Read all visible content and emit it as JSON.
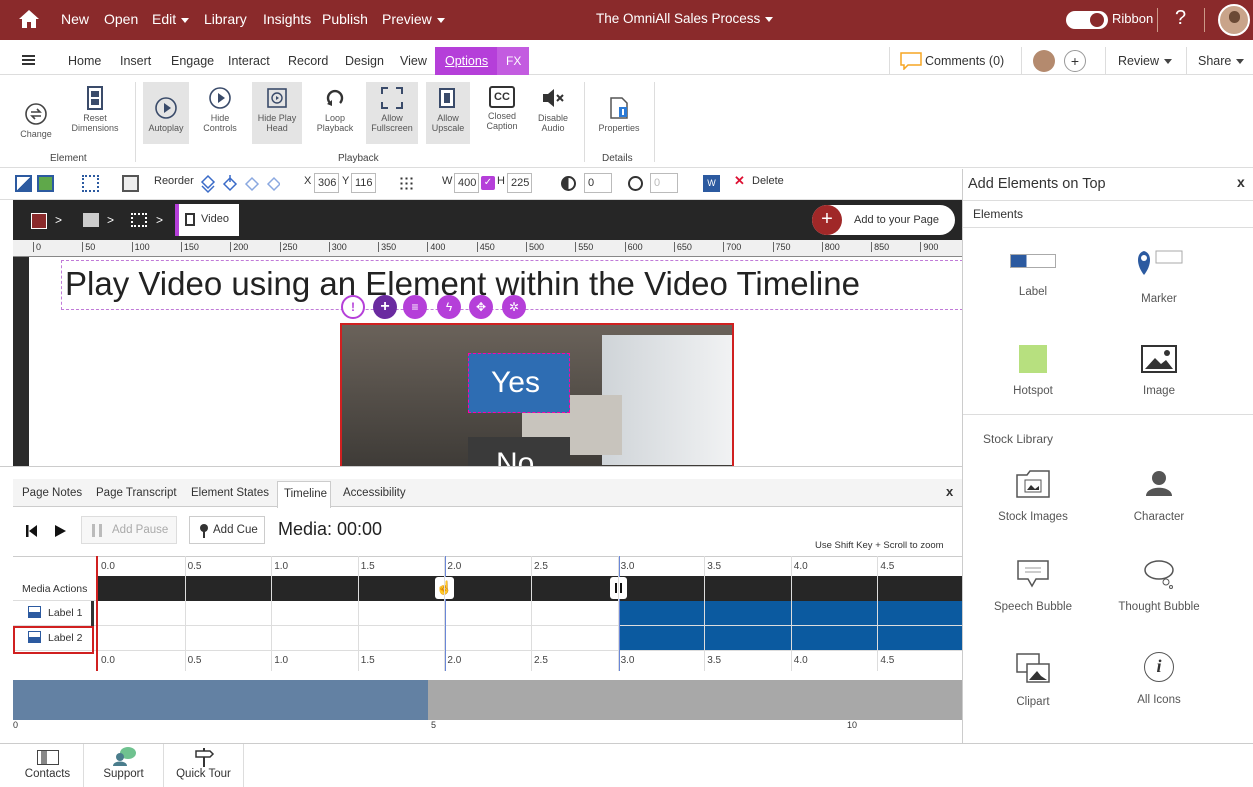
{
  "topbar": {
    "menu": {
      "new": "New",
      "open": "Open",
      "edit": "Edit",
      "library": "Library",
      "insights": "Insights",
      "publish": "Publish",
      "preview": "Preview"
    },
    "title": "The OmniAll Sales Process",
    "ribbon_toggle": "Ribbon",
    "help": "?"
  },
  "tabs": {
    "home": "Home",
    "insert": "Insert",
    "engage": "Engage",
    "interact": "Interact",
    "record": "Record",
    "design": "Design",
    "view": "View",
    "options": "Options",
    "fx": "FX",
    "comments": "Comments (0)",
    "review": "Review",
    "share": "Share"
  },
  "ribbon": {
    "change": "Change",
    "reset": "Reset Dimensions",
    "autoplay": "Autoplay",
    "hide_controls": "Hide Controls",
    "hide_play_head": "Hide Play Head",
    "loop": "Loop Playback",
    "allow_fullscreen": "Allow Fullscreen",
    "allow_upscale": "Allow Upscale",
    "closed_caption": "Closed Caption",
    "disable_audio": "Disable Audio",
    "properties": "Properties",
    "cc_glyph": "CC",
    "groups": {
      "element": "Element",
      "playback": "Playback",
      "details": "Details"
    }
  },
  "toolbar": {
    "reorder": "Reorder",
    "x_label": "X",
    "x": "306",
    "y_label": "Y",
    "y": "116",
    "w_label": "W",
    "w": "400",
    "h_label": "H",
    "h": "225",
    "opacity": "0",
    "rotation": "0",
    "delete": "Delete"
  },
  "breadcrumb": {
    "video": "Video",
    "add_to_page": "Add to your Page"
  },
  "ruler": [
    "0",
    "50",
    "100",
    "150",
    "200",
    "250",
    "300",
    "350",
    "400",
    "450",
    "500",
    "550",
    "600",
    "650",
    "700",
    "750",
    "800",
    "850",
    "900"
  ],
  "canvas": {
    "heading": "Play Video using an Element within the Video Timeline",
    "yes": "Yes",
    "no": "No"
  },
  "panel": {
    "title": "Add Elements on Top",
    "close": "x",
    "elements_title": "Elements",
    "elements": [
      "Label",
      "Marker",
      "Hotspot",
      "Image"
    ],
    "stock_title": "Stock Library",
    "stock": [
      "Stock Images",
      "Character",
      "Speech Bubble",
      "Thought Bubble",
      "Clipart",
      "All Icons"
    ]
  },
  "bottom": {
    "tabs": [
      "Page Notes",
      "Page Transcript",
      "Element States",
      "Timeline",
      "Accessibility"
    ],
    "close": "x",
    "add_pause": "Add Pause",
    "add_cue": "Add Cue",
    "media": "Media: 00:00",
    "zoom_hint": "Use Shift Key + Scroll to zoom",
    "ticks": [
      "0.0",
      "0.5",
      "1.0",
      "1.5",
      "2.0",
      "2.5",
      "3.0",
      "3.5",
      "4.0",
      "4.5"
    ],
    "rows": [
      "Media Actions",
      "Label 1",
      "Label 2"
    ],
    "scale": [
      "0",
      "5",
      "10"
    ]
  },
  "footer": [
    "Contacts",
    "Support",
    "Quick Tour"
  ],
  "colors": {
    "brand": "#8a2a2b",
    "accent": "#b53fd9",
    "timeline_bar": "#0b5aa0",
    "selection": "#e03030"
  }
}
